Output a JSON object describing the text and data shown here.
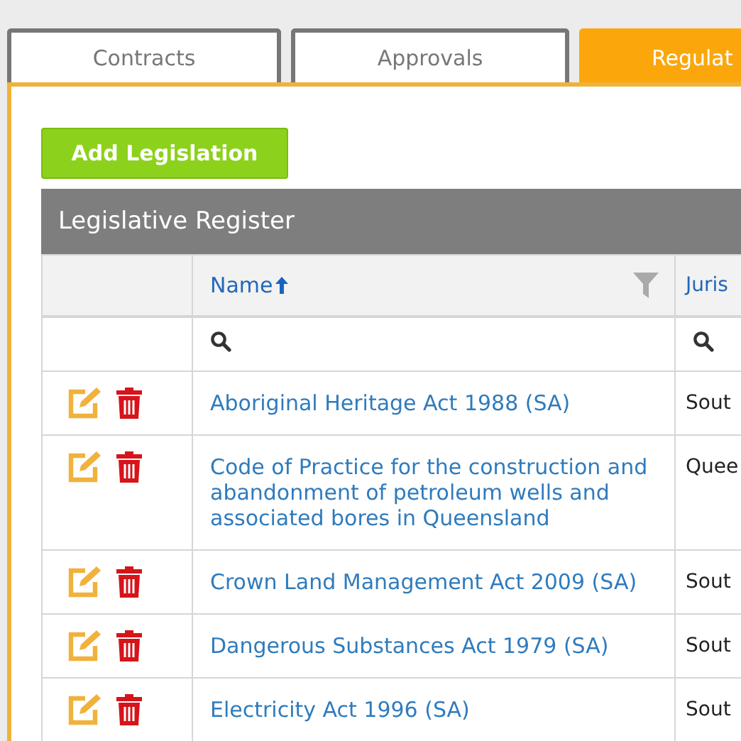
{
  "tabs": [
    {
      "label": "Contracts",
      "selected": false
    },
    {
      "label": "Approvals",
      "selected": false
    },
    {
      "label": "Regulat",
      "selected": true
    }
  ],
  "add_button": "Add Legislation",
  "table": {
    "title": "Legislative Register",
    "columns": [
      {
        "label": "Name",
        "sorted": true,
        "filterable": true
      },
      {
        "label": "Juris",
        "sorted": false,
        "filterable": false
      }
    ],
    "rows": [
      {
        "name": "Aboriginal Heritage Act 1988 (SA)",
        "jurisdiction": "Sout"
      },
      {
        "name": "Code of Practice for the construction and abandonment of petroleum wells and associated bores in Queensland",
        "jurisdiction": "Quee"
      },
      {
        "name": "Crown Land Management Act 2009 (SA)",
        "jurisdiction": "Sout"
      },
      {
        "name": "Dangerous Substances Act 1979 (SA)",
        "jurisdiction": "Sout"
      },
      {
        "name": "Electricity Act 1996 (SA)",
        "jurisdiction": "Sout"
      }
    ]
  }
}
